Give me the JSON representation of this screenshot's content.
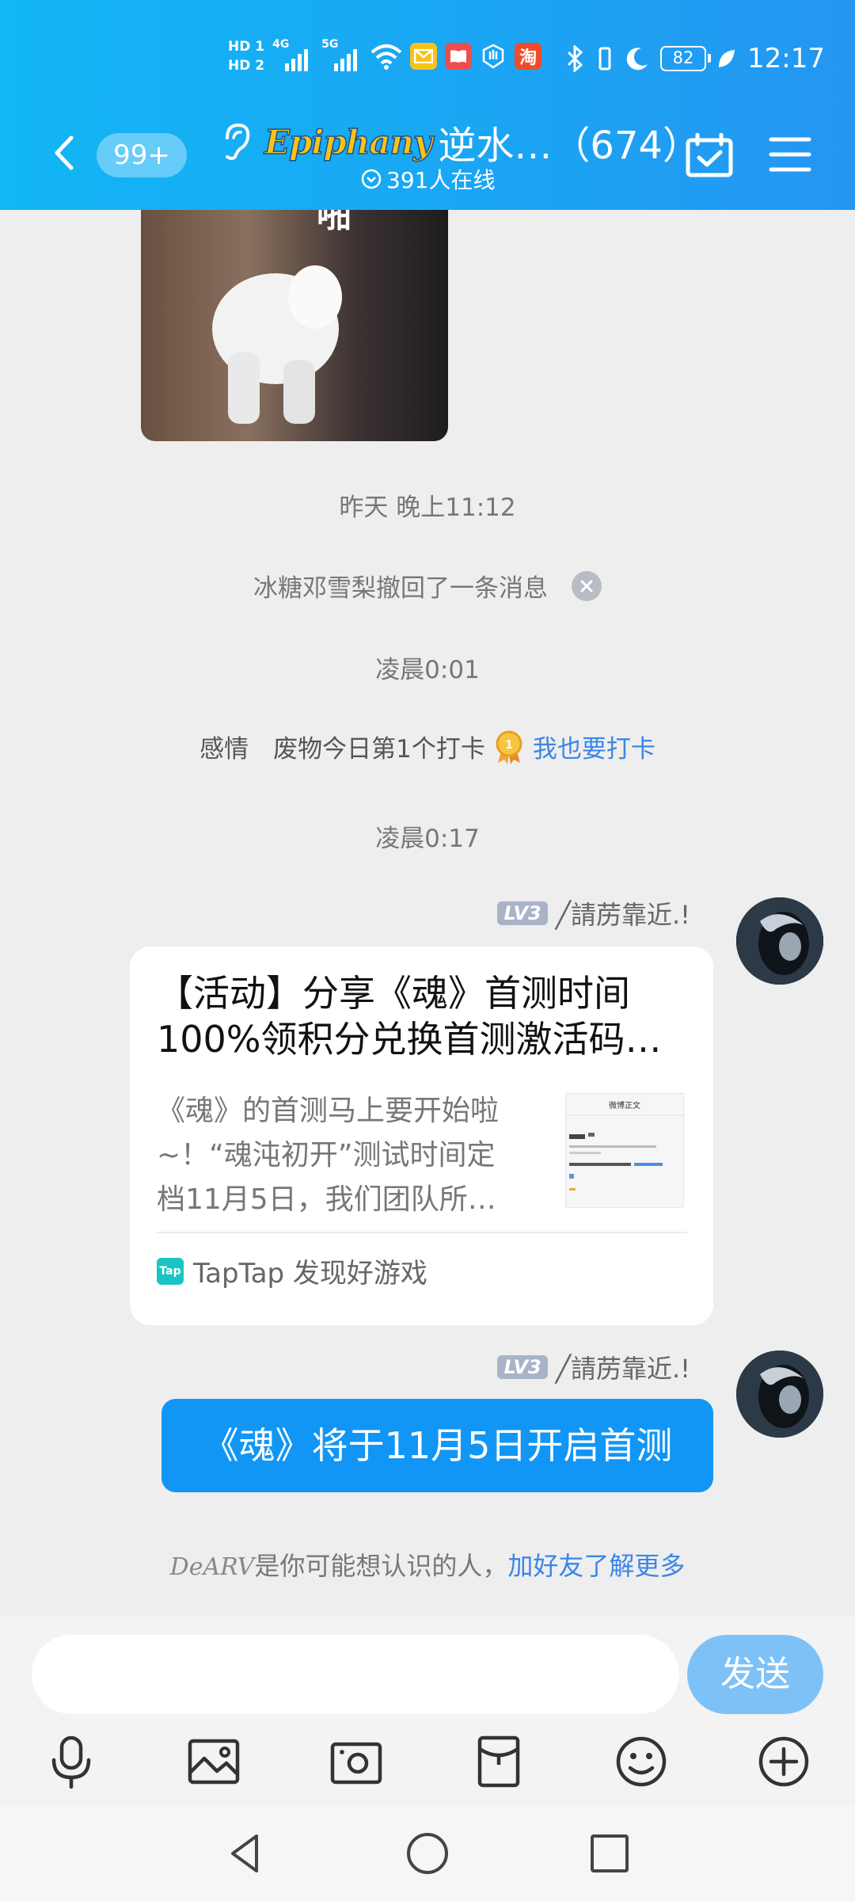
{
  "status_bar": {
    "hd1": "HD 1",
    "hd2": "HD 2",
    "net1": "4G",
    "net2": "5G",
    "battery": "82",
    "time": "12:17",
    "app_icons": [
      "mail-icon",
      "book-icon",
      "hand-icon",
      "taobao-icon"
    ],
    "taobao_label": "淘"
  },
  "header": {
    "unread_badge": "99+",
    "brand": "Epiphany",
    "title": "逆水…（674）",
    "online": "391人在线"
  },
  "chat": {
    "photo_caption": "啪",
    "timestamps": [
      "昨天 晚上11:12",
      "凌晨0:01",
      "凌晨0:17"
    ],
    "revoke_notice": "冰糖邓雪梨撤回了一条消息",
    "checkin": {
      "text": "感情　废物今日第1个打卡",
      "link": "我也要打卡",
      "medal_number": "1"
    },
    "sender": {
      "level": "LV3",
      "name": "╱請苈靠近.!"
    },
    "share_card": {
      "title_lines": [
        "【活动】分享《魂》首测时间",
        "100%领积分兑换首测激活码…"
      ],
      "desc_lines": [
        "《魂》的首测马上要开始啦",
        "~！“魂沌初开”测试时间定",
        "档11月5日，我们团队所…"
      ],
      "thumb_header": "微博正文",
      "source_logo": "Tap",
      "source": "TapTap 发现好游戏"
    },
    "message": "《魂》将于11月5日开启首测",
    "suggest": {
      "name": "DeARV",
      "text": "是你可能想认识的人，",
      "link": "加好友了解更多"
    }
  },
  "input": {
    "placeholder": "",
    "send_label": "发送",
    "tools": [
      "microphone-icon",
      "image-icon",
      "camera-icon",
      "red-packet-icon",
      "emoji-icon",
      "plus-icon"
    ]
  },
  "colors": {
    "header": "#1aa6f3",
    "bubble": "#1296f5",
    "link": "#3a86e8",
    "send": "#7ec1f6"
  }
}
